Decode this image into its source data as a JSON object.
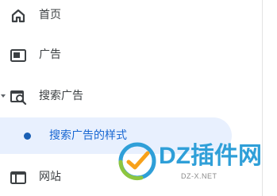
{
  "sidebar": {
    "items": [
      {
        "id": "home",
        "label": "首页",
        "icon": "home-icon"
      },
      {
        "id": "ads",
        "label": "广告",
        "icon": "ad-frame-icon"
      },
      {
        "id": "search-ads",
        "label": "搜索广告",
        "icon": "search-ads-icon",
        "expanded": true
      },
      {
        "id": "search-ads-style",
        "label": "搜索广告的样式",
        "icon": "bullet-dot-icon",
        "selected": true
      },
      {
        "id": "site",
        "label": "网站",
        "icon": "site-window-icon"
      }
    ]
  },
  "watermark": {
    "title": "DZ插件网",
    "subtitle": "DZ-X.NET"
  },
  "colors": {
    "text": "#3c4043",
    "selected_bg": "#e8f0fe",
    "selected_text": "#1967d2",
    "watermark_blue": "#2f9fd8"
  }
}
